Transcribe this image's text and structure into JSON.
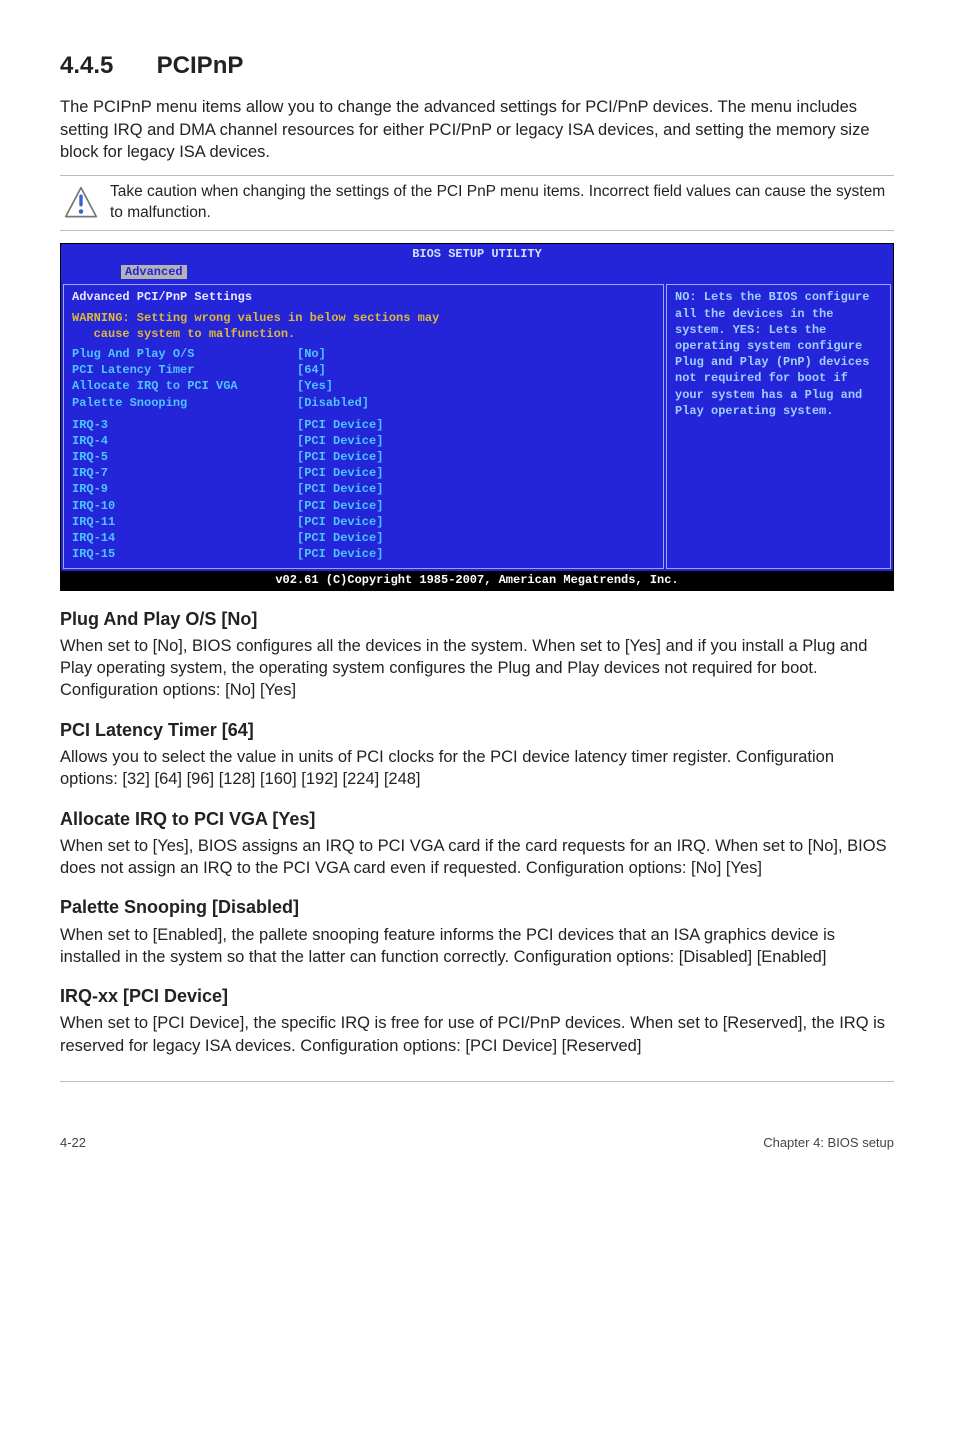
{
  "section": {
    "number": "4.4.5",
    "title": "PCIPnP"
  },
  "intro": "The PCIPnP menu items allow you to change the advanced settings for PCI/PnP devices. The menu includes setting IRQ and DMA channel resources for either PCI/PnP or legacy ISA devices, and setting the memory size block for legacy ISA devices.",
  "caution": "Take caution when changing the settings of the PCI PnP menu items. Incorrect field values can cause the system to malfunction.",
  "bios": {
    "title": "BIOS SETUP UTILITY",
    "tab": "Advanced",
    "left_heading": "Advanced PCI/PnP Settings",
    "warning_line1": "WARNING: Setting wrong values in below sections may",
    "warning_line2": "   cause system to malfunction.",
    "settings": [
      {
        "k": "Plug And Play O/S",
        "v": "[No]"
      },
      {
        "k": "PCI Latency Timer",
        "v": "[64]"
      },
      {
        "k": "Allocate IRQ to PCI VGA",
        "v": "[Yes]"
      },
      {
        "k": "Palette Snooping",
        "v": "[Disabled]"
      }
    ],
    "irqs": [
      {
        "k": "IRQ-3",
        "v": "[PCI Device]"
      },
      {
        "k": "IRQ-4",
        "v": "[PCI Device]"
      },
      {
        "k": "IRQ-5",
        "v": "[PCI Device]"
      },
      {
        "k": "IRQ-7",
        "v": "[PCI Device]"
      },
      {
        "k": "IRQ-9",
        "v": "[PCI Device]"
      },
      {
        "k": "IRQ-10",
        "v": "[PCI Device]"
      },
      {
        "k": "IRQ-11",
        "v": "[PCI Device]"
      },
      {
        "k": "IRQ-14",
        "v": "[PCI Device]"
      },
      {
        "k": "IRQ-15",
        "v": "[PCI Device]"
      }
    ],
    "help_text": "NO: Lets the BIOS configure all the devices in the system. YES: Lets the operating system configure Plug and Play (PnP) devices not required for boot if your system has a Plug and Play operating system.",
    "footer": "v02.61 (C)Copyright 1985-2007, American Megatrends, Inc."
  },
  "items": [
    {
      "title": "Plug And Play O/S [No]",
      "body": "When set to [No], BIOS configures all the devices in the system. When set to [Yes] and if you install a Plug and Play operating system, the operating system configures the Plug and Play devices not required for boot. Configuration options: [No] [Yes]"
    },
    {
      "title": "PCI Latency Timer [64]",
      "body": "Allows you to select the value in units of PCI clocks for the PCI device latency timer register. Configuration options: [32] [64] [96] [128] [160] [192] [224] [248]"
    },
    {
      "title": "Allocate IRQ to PCI VGA [Yes]",
      "body": "When set to [Yes], BIOS assigns an IRQ to PCI VGA card if the card requests for an IRQ. When set to [No], BIOS does not assign an IRQ to the PCI VGA card even if requested. Configuration options: [No] [Yes]"
    },
    {
      "title": "Palette Snooping [Disabled]",
      "body": "When set to [Enabled], the pallete snooping feature informs the PCI devices that an ISA graphics device is installed in the system so that the latter can function correctly. Configuration options: [Disabled] [Enabled]"
    },
    {
      "title": "IRQ-xx [PCI Device]",
      "body": "When set to [PCI Device], the specific IRQ is free for use of PCI/PnP devices. When set to [Reserved], the IRQ is reserved for legacy ISA devices. Configuration options: [PCI Device] [Reserved]"
    }
  ],
  "footer": {
    "left": "4-22",
    "right": "Chapter 4: BIOS setup"
  }
}
